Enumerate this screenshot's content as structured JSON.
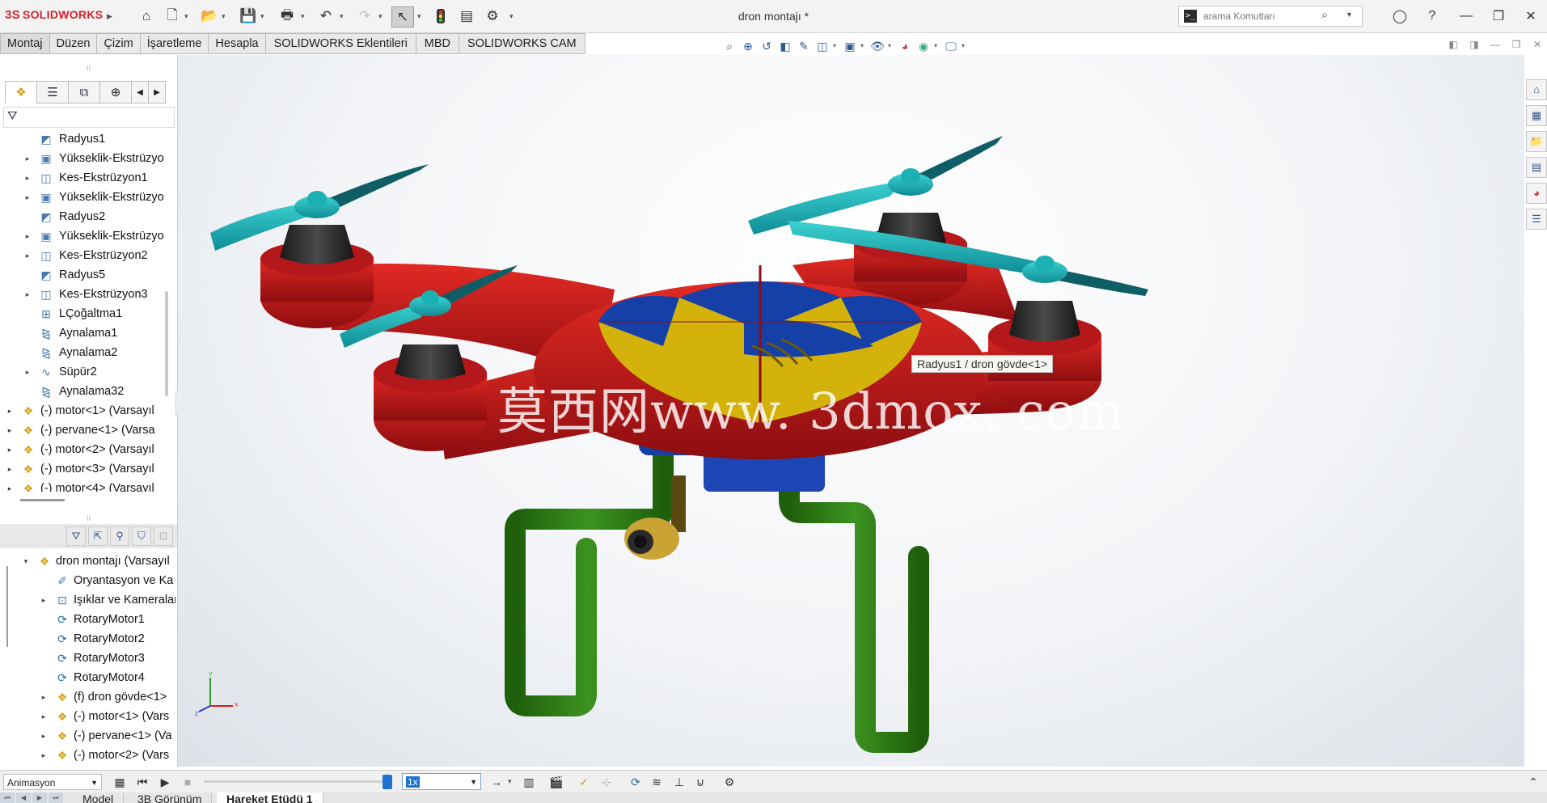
{
  "app": {
    "logo_prefix": "3S",
    "logo_text": "SOLIDWORKS",
    "document_title": "dron montajı *"
  },
  "search": {
    "placeholder": "arama Komutları"
  },
  "command_tabs": [
    "Montaj",
    "Düzen",
    "Çizim",
    "İşaretleme",
    "Hesapla",
    "SOLIDWORKS Eklentileri",
    "MBD",
    "SOLIDWORKS CAM"
  ],
  "feature_tree": [
    {
      "label": "Radyus1",
      "type": "feat",
      "icon": "fillet-icon",
      "expandable": false
    },
    {
      "label": "Yükseklik-Ekstrüzyo",
      "type": "feat",
      "icon": "boss-extrude-icon",
      "expandable": true
    },
    {
      "label": "Kes-Ekstrüzyon1",
      "type": "feat",
      "icon": "cut-extrude-icon",
      "expandable": true
    },
    {
      "label": "Yükseklik-Ekstrüzyo",
      "type": "feat",
      "icon": "boss-extrude-icon",
      "expandable": true
    },
    {
      "label": "Radyus2",
      "type": "feat",
      "icon": "fillet-icon",
      "expandable": false
    },
    {
      "label": "Yükseklik-Ekstrüzyo",
      "type": "feat",
      "icon": "boss-extrude-icon",
      "expandable": true
    },
    {
      "label": "Kes-Ekstrüzyon2",
      "type": "feat",
      "icon": "cut-extrude-icon",
      "expandable": true
    },
    {
      "label": "Radyus5",
      "type": "feat",
      "icon": "fillet-icon",
      "expandable": false
    },
    {
      "label": "Kes-Ekstrüzyon3",
      "type": "feat",
      "icon": "cut-extrude-icon",
      "expandable": true
    },
    {
      "label": "LÇoğaltma1",
      "type": "feat",
      "icon": "linear-pattern-icon",
      "expandable": false
    },
    {
      "label": "Aynalama1",
      "type": "feat",
      "icon": "mirror-icon",
      "expandable": false
    },
    {
      "label": "Aynalama2",
      "type": "feat",
      "icon": "mirror-icon",
      "expandable": false
    },
    {
      "label": "Süpür2",
      "type": "feat",
      "icon": "sweep-icon",
      "expandable": true
    },
    {
      "label": "Aynalama32",
      "type": "feat",
      "icon": "mirror-icon",
      "expandable": false
    },
    {
      "label": "(-) motor<1> (Varsayıl",
      "type": "comp",
      "icon": "component-icon",
      "expandable": true
    },
    {
      "label": "(-) pervane<1> (Varsa",
      "type": "comp",
      "icon": "component-icon",
      "expandable": true
    },
    {
      "label": "(-) motor<2> (Varsayıl",
      "type": "comp",
      "icon": "component-icon",
      "expandable": true
    },
    {
      "label": "(-) motor<3> (Varsayıl",
      "type": "comp",
      "icon": "component-icon",
      "expandable": true
    },
    {
      "label": "(-) motor<4> (Varsayıl",
      "type": "comp",
      "icon": "component-icon",
      "expandable": true
    }
  ],
  "motion_tree": [
    {
      "label": "dron montajı (Varsayıl",
      "icon": "assembly-icon",
      "expandable": "open",
      "indent": 0
    },
    {
      "label": "Oryantasyon ve Ka",
      "icon": "orientation-icon",
      "expandable": "none",
      "indent": 1
    },
    {
      "label": "Işıklar ve Kameralar",
      "icon": "lights-cameras-icon",
      "expandable": "closed",
      "indent": 1
    },
    {
      "label": "RotaryMotor1",
      "icon": "rotary-motor-icon",
      "expandable": "none",
      "indent": 1
    },
    {
      "label": "RotaryMotor2",
      "icon": "rotary-motor-icon",
      "expandable": "none",
      "indent": 1
    },
    {
      "label": "RotaryMotor3",
      "icon": "rotary-motor-icon",
      "expandable": "none",
      "indent": 1
    },
    {
      "label": "RotaryMotor4",
      "icon": "rotary-motor-icon",
      "expandable": "none",
      "indent": 1
    },
    {
      "label": "(f) dron gövde<1>",
      "icon": "component-icon",
      "expandable": "closed",
      "indent": 1
    },
    {
      "label": "(-) motor<1> (Vars",
      "icon": "component-icon",
      "expandable": "closed",
      "indent": 1
    },
    {
      "label": "(-) pervane<1> (Va",
      "icon": "component-icon",
      "expandable": "closed",
      "indent": 1
    },
    {
      "label": "(-) motor<2> (Vars",
      "icon": "component-icon",
      "expandable": "closed",
      "indent": 1
    }
  ],
  "viewport": {
    "tooltip": "Radyus1 / dron gövde<1>",
    "watermark": "莫西网www. 3dmox. com",
    "triad": {
      "x": "X",
      "y": "Y",
      "z": "Z"
    }
  },
  "colors": {
    "body_red": "#c8191c",
    "body_yellow": "#d4b20c",
    "body_blue": "#1540a8",
    "propeller_cyan": "#1fb3b8",
    "motor_black": "#2a2a2a",
    "landing_gear_green": "#2e7a12"
  },
  "motion_bar": {
    "study_type": "Animasyon",
    "playback_speed": "1x"
  },
  "bottom_tabs": [
    "Model",
    "3B Görünüm",
    "Hareket Etüdü 1"
  ],
  "active_bottom_tab": "Hareket Etüdü 1"
}
